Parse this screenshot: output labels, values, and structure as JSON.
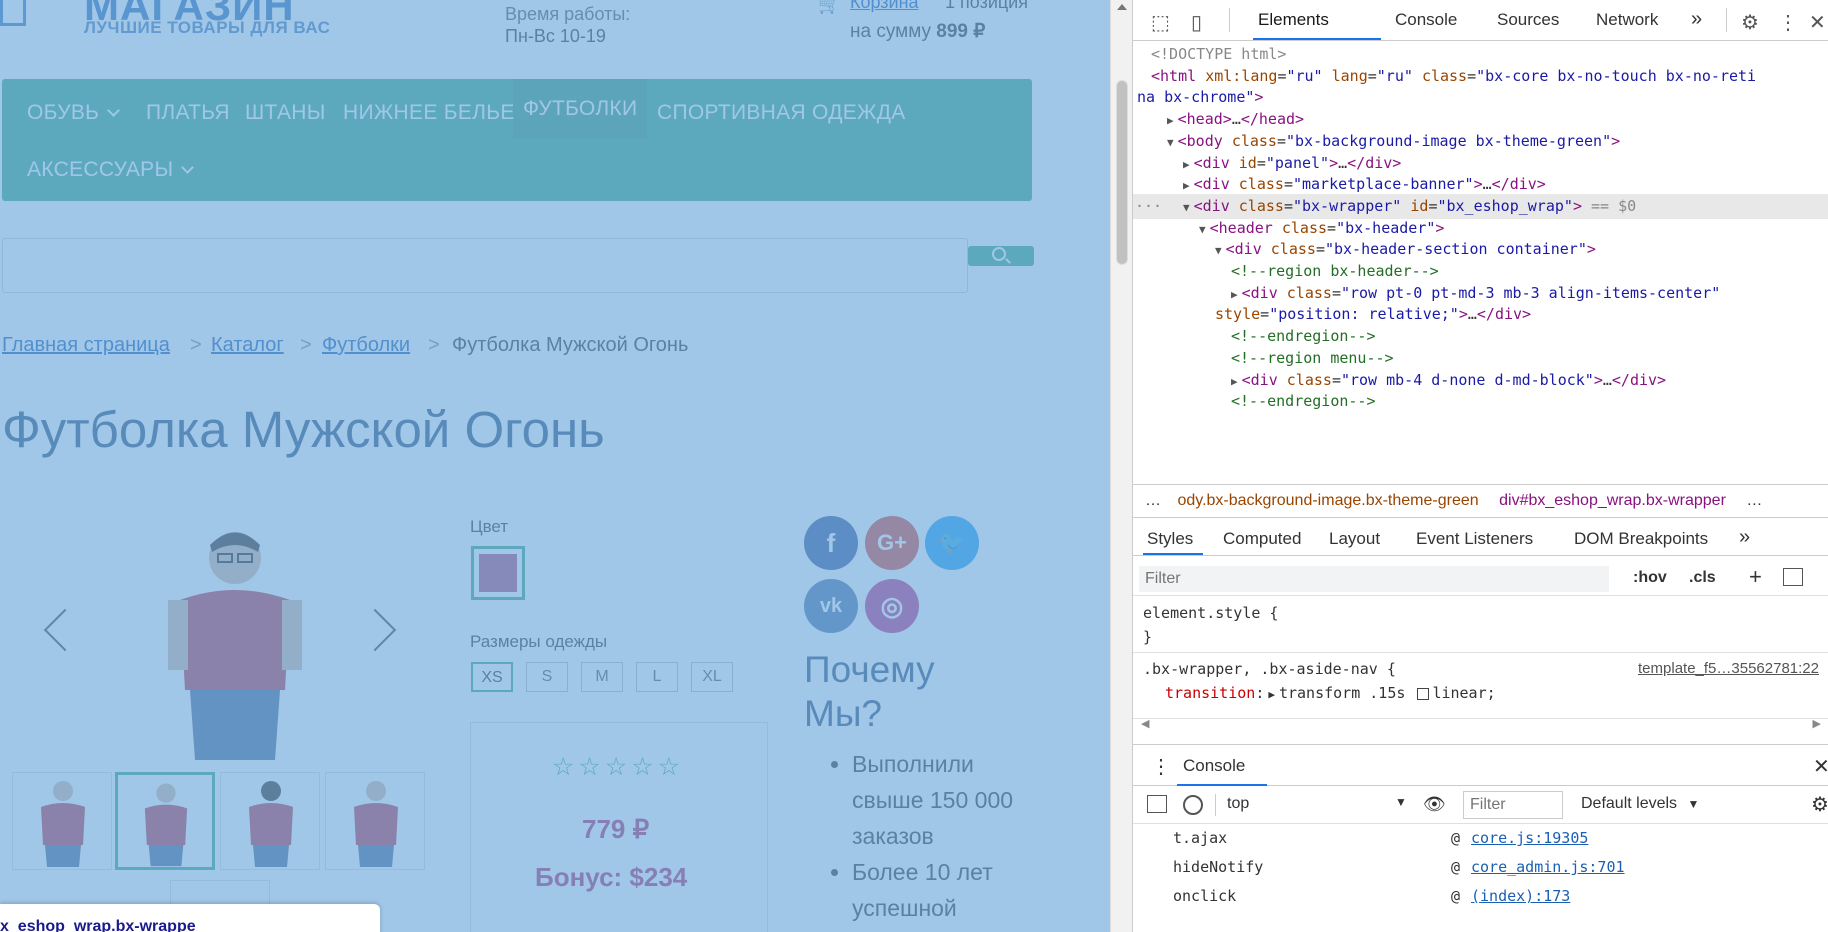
{
  "page": {
    "logo": {
      "title": "МАГАЗИН",
      "subtitle": "ЛУЧШИЕ ТОВАРЫ ДЛЯ ВАС"
    },
    "hours": {
      "label": "Время работы:",
      "value": "Пн-Вс 10-19"
    },
    "cart": {
      "link": "Корзина",
      "count": "1 позиция",
      "sum_prefix": "на сумму",
      "sum_value": "899 ₽"
    },
    "menu": [
      {
        "label": "ОБУВЬ",
        "has_dropdown": true
      },
      {
        "label": "ПЛАТЬЯ"
      },
      {
        "label": "ШТАНЫ"
      },
      {
        "label": "НИЖНЕЕ БЕЛЬЕ"
      },
      {
        "label": "ФУТБОЛКИ",
        "active": true
      },
      {
        "label": "СПОРТИВНАЯ ОДЕЖДА"
      },
      {
        "label": "АКСЕССУАРЫ",
        "has_dropdown": true
      }
    ],
    "breadcrumb": [
      "Главная страница",
      "Каталог",
      "Футболки",
      "Футболка Мужской Огонь"
    ],
    "breadcrumb_sep": ">",
    "product_title": "Футболка Мужской Огонь",
    "color_label": "Цвет",
    "color_value_hex": "#b04f7a",
    "size_label": "Размеры одежды",
    "sizes": [
      "XS",
      "S",
      "M",
      "L",
      "XL"
    ],
    "selected_size": "XS",
    "rating_stars": "☆☆☆☆☆",
    "price": "779 ₽",
    "bonus": "Бонус: $234",
    "social": [
      {
        "name": "facebook-icon",
        "glyph": "f",
        "color": "#3b5998"
      },
      {
        "name": "google-plus-icon",
        "glyph": "G+",
        "color": "#dd4b39"
      },
      {
        "name": "twitter-icon",
        "glyph": "🐦",
        "color": "#1da1f2"
      },
      {
        "name": "vk-icon",
        "glyph": "vk",
        "color": "#4c75a3"
      },
      {
        "name": "instagram-icon",
        "glyph": "◎",
        "color": "#c13584"
      }
    ],
    "why_title": "Почему Мы?",
    "why_items": [
      "Выполнили свыше 150 000 заказов",
      "Более 10 лет успешной"
    ],
    "hover_tooltip": "x_eshop_wrap.bx-wrappe"
  },
  "devtools": {
    "tabs": [
      "Elements",
      "Console",
      "Sources",
      "Network",
      "»"
    ],
    "active_tab": "Elements",
    "dom_lines": [
      {
        "indent": 0,
        "html": "<span class='gy'>&lt;!DOCTYPE html&gt;</span>"
      },
      {
        "indent": 0,
        "html": "<span class='tg'>&lt;html</span> <span class='at'>xml:lang</span>=<span class='av'>\"ru\"</span> <span class='at'>lang</span>=<span class='av'>\"ru\"</span> <span class='at'>class</span>=<span class='av'>\"bx-core bx-no-touch bx-no-reti</span>"
      },
      {
        "indent": -1,
        "html": "<span class='av'>na bx-chrome\"</span><span class='tg'>&gt;</span>"
      },
      {
        "indent": 1,
        "tri": "▶",
        "html": "<span class='tg'>&lt;head&gt;</span>…<span class='tg'>&lt;/head&gt;</span>"
      },
      {
        "indent": 1,
        "tri": "▼",
        "html": "<span class='tg'>&lt;body</span> <span class='at'>class</span>=<span class='av'>\"bx-background-image bx-theme-green\"</span><span class='tg'>&gt;</span>"
      },
      {
        "indent": 2,
        "tri": "▶",
        "html": "<span class='tg'>&lt;div</span> <span class='at'>id</span>=<span class='av'>\"panel\"</span><span class='tg'>&gt;</span>…<span class='tg'>&lt;/div&gt;</span>"
      },
      {
        "indent": 2,
        "tri": "▶",
        "html": "<span class='tg'>&lt;div</span> <span class='at'>class</span>=<span class='av'>\"marketplace-banner\"</span><span class='tg'>&gt;</span>…<span class='tg'>&lt;/div&gt;</span>"
      },
      {
        "indent": 2,
        "tri": "▼",
        "sel": true,
        "html": "<span class='tg'>&lt;div</span> <span class='at'>class</span>=<span class='av'>\"bx-wrapper\"</span> <span class='at'>id</span>=<span class='av'>\"bx_eshop_wrap\"</span><span class='tg'>&gt;</span> <span class='gy'>== $0</span>"
      },
      {
        "indent": 3,
        "tri": "▼",
        "html": "<span class='tg'>&lt;header</span> <span class='at'>class</span>=<span class='av'>\"bx-header\"</span><span class='tg'>&gt;</span>"
      },
      {
        "indent": 4,
        "tri": "▼",
        "html": "<span class='tg'>&lt;div</span> <span class='at'>class</span>=<span class='av'>\"bx-header-section container\"</span><span class='tg'>&gt;</span>"
      },
      {
        "indent": 5,
        "html": "<span class='cm'>&lt;!--region bx-header--&gt;</span>"
      },
      {
        "indent": 5,
        "tri": "▶",
        "html": "<span class='tg'>&lt;div</span> <span class='at'>class</span>=<span class='av'>\"row pt-0 pt-md-3 mb-3 align-items-center\"</span>"
      },
      {
        "indent": 4,
        "html": "<span class='at'>style</span>=<span class='av'>\"position: relative;\"</span><span class='tg'>&gt;</span>…<span class='tg'>&lt;/div&gt;</span>"
      },
      {
        "indent": 5,
        "html": "<span class='cm'>&lt;!--endregion--&gt;</span>"
      },
      {
        "indent": 5,
        "html": "<span class='cm'>&lt;!--region menu--&gt;</span>"
      },
      {
        "indent": 5,
        "tri": "▶",
        "html": "<span class='tg'>&lt;div</span> <span class='at'>class</span>=<span class='av'>\"row mb-4 d-none d-md-block\"</span><span class='tg'>&gt;</span>…<span class='tg'>&lt;/div&gt;</span>"
      },
      {
        "indent": 5,
        "html": "<span class='cm'>&lt;!--endregion--&gt;</span>"
      }
    ],
    "breadcrumbs": [
      "…",
      "ody.bx-background-image.bx-theme-green",
      "div#bx_eshop_wrap.bx-wrapper",
      "…"
    ],
    "style_tabs": [
      "Styles",
      "Computed",
      "Layout",
      "Event Listeners",
      "DOM Breakpoints",
      "»"
    ],
    "filter_placeholder": "Filter",
    "filter_hov": ":hov",
    "filter_cls": ".cls",
    "rules": {
      "element_style_open": "element.style {",
      "element_style_close": "}",
      "selector": ".bx-wrapper, .bx-aside-nav {",
      "source": "template_f5…35562781:22",
      "prop": "transition",
      "value_a": "transform .15s",
      "value_b": "linear;"
    },
    "console": {
      "drawer_title": "Console",
      "context": "top",
      "filter_placeholder": "Filter",
      "levels": "Default levels",
      "rows": [
        {
          "name": "t.ajax",
          "src": "core.js:19305"
        },
        {
          "name": "hideNotify",
          "src": "core_admin.js:701"
        },
        {
          "name": "onclick",
          "src": "(index):173"
        }
      ]
    }
  }
}
